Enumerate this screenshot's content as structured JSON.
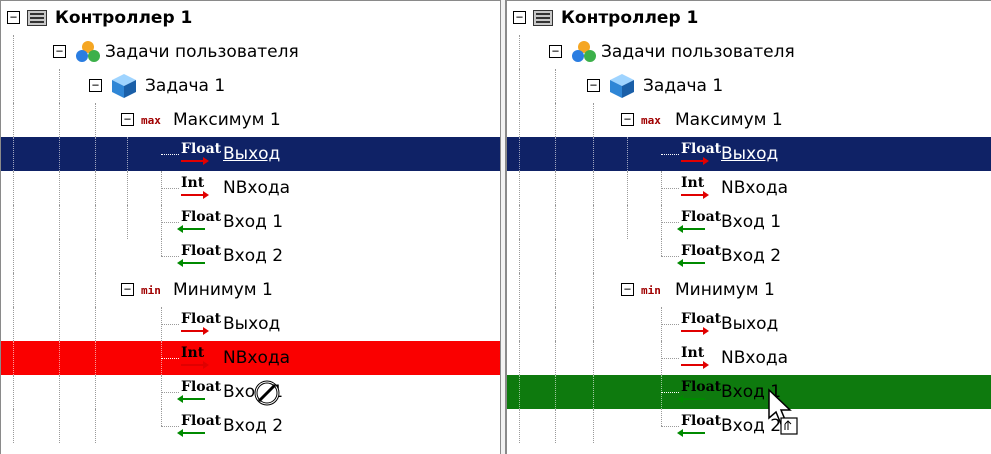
{
  "left_panel": {
    "controller": {
      "label": "Контроллер 1",
      "icon": "controller-icon"
    },
    "user_tasks": {
      "label": "Задачи пользователя",
      "icon": "user-tasks-icon"
    },
    "task": {
      "label": "Задача 1",
      "icon": "task-cube-icon"
    },
    "max_block": {
      "tag": "max",
      "label": "Максимум 1"
    },
    "max_output": {
      "type": "Float",
      "label": "Выход"
    },
    "max_ninput": {
      "type": "Int",
      "label": "NВхода"
    },
    "max_input1": {
      "type": "Float",
      "label": "Вход 1"
    },
    "max_input2": {
      "type": "Float",
      "label": "Вход 2"
    },
    "min_block": {
      "tag": "min",
      "label": "Минимум 1"
    },
    "min_output": {
      "type": "Float",
      "label": "Выход"
    },
    "min_ninput": {
      "type": "Int",
      "label": "NВхода"
    },
    "min_input1": {
      "type": "Float",
      "label": "Вход 1"
    },
    "min_input2": {
      "type": "Float",
      "label": "Вход 2"
    }
  },
  "right_panel": {
    "controller": {
      "label": "Контроллер 1",
      "icon": "controller-icon"
    },
    "user_tasks": {
      "label": "Задачи пользователя",
      "icon": "user-tasks-icon"
    },
    "task": {
      "label": "Задача 1",
      "icon": "task-cube-icon"
    },
    "max_block": {
      "tag": "max",
      "label": "Максимум 1"
    },
    "max_output": {
      "type": "Float",
      "label": "Выход"
    },
    "max_ninput": {
      "type": "Int",
      "label": "NВхода"
    },
    "max_input1": {
      "type": "Float",
      "label": "Вход 1"
    },
    "max_input2": {
      "type": "Float",
      "label": "Вход 2"
    },
    "min_block": {
      "tag": "min",
      "label": "Минимум 1"
    },
    "min_output": {
      "type": "Float",
      "label": "Выход"
    },
    "min_ninput": {
      "type": "Int",
      "label": "NВхода"
    },
    "min_input1": {
      "type": "Float",
      "label": "Вход 1"
    },
    "min_input2": {
      "type": "Float",
      "label": "Вход 2"
    }
  },
  "toggle_symbol": "−",
  "colors": {
    "selection_navy": "#0f2266",
    "drop_invalid_red": "#fa0000",
    "drop_valid_green": "#0e7a0e",
    "output_arrow": "#e00000",
    "input_arrow": "#008a00"
  },
  "cursors": {
    "left": "no-drop-cursor",
    "right": "drag-copy-cursor"
  }
}
